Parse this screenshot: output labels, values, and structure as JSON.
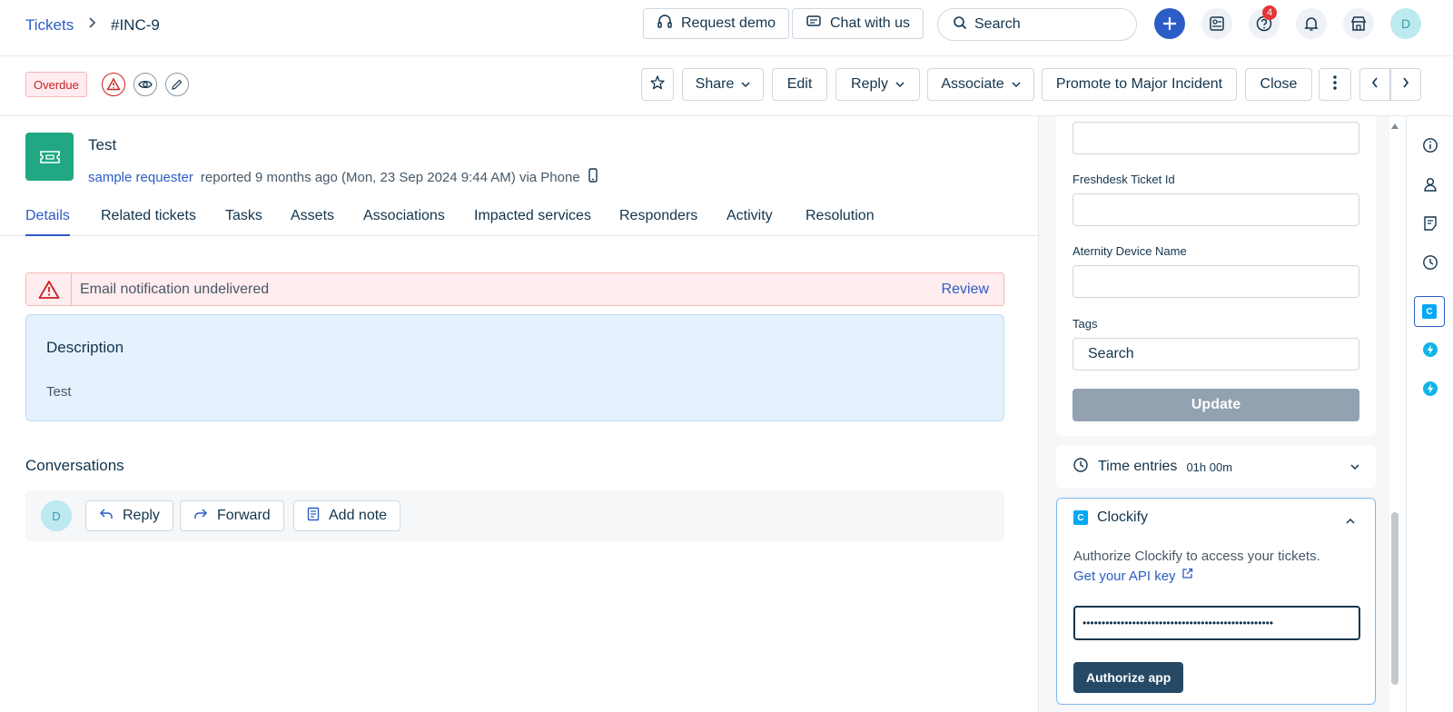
{
  "breadcrumb": {
    "parent": "Tickets",
    "separator": "›",
    "current": "#INC-9"
  },
  "header": {
    "request_demo": "Request demo",
    "chat_with_us": "Chat with us",
    "search_placeholder": "Search",
    "help_badge_count": "4",
    "avatar_initial": "D"
  },
  "toolbar": {
    "status_badge": "Overdue",
    "share": "Share",
    "edit": "Edit",
    "reply": "Reply",
    "associate": "Associate",
    "promote": "Promote to Major Incident",
    "close": "Close"
  },
  "ticket": {
    "title": "Test",
    "requester": "sample requester",
    "reported_text": "reported 9 months ago (Mon, 23 Sep 2024 9:44 AM) via Phone"
  },
  "tabs": [
    {
      "label": "Details",
      "active": true
    },
    {
      "label": "Related tickets"
    },
    {
      "label": "Tasks"
    },
    {
      "label": "Assets"
    },
    {
      "label": "Associations"
    },
    {
      "label": "Impacted services"
    },
    {
      "label": "Responders"
    },
    {
      "label": "Activity"
    },
    {
      "label": "Resolution"
    }
  ],
  "alert": {
    "message": "Email notification undelivered",
    "action": "Review"
  },
  "description": {
    "title": "Description",
    "body": "Test"
  },
  "conversations": {
    "title": "Conversations",
    "avatar_initial": "D",
    "reply": "Reply",
    "forward": "Forward",
    "add_note": "Add note"
  },
  "properties": {
    "freshdesk_label": "Freshdesk Ticket Id",
    "freshdesk_value": "",
    "aternity_label": "Aternity Device Name",
    "aternity_value": "",
    "tags_label": "Tags",
    "tags_placeholder": "Search",
    "update": "Update"
  },
  "time_entries": {
    "title": "Time entries",
    "total": "01h 00m"
  },
  "clockify": {
    "logo_letter": "C",
    "title": "Clockify",
    "message": "Authorize Clockify to access your tickets.",
    "api_link": "Get your API key",
    "api_key_masked": "••••••••••••••••••••••••••••••••••••••••••••••••••",
    "authorize": "Authorize app"
  },
  "colors": {
    "primary": "#2c5cc5",
    "overdue_red": "#c82124",
    "ticket_green": "#1fa882",
    "clockify_blue": "#03a9f4",
    "authorize_navy": "#264966"
  }
}
